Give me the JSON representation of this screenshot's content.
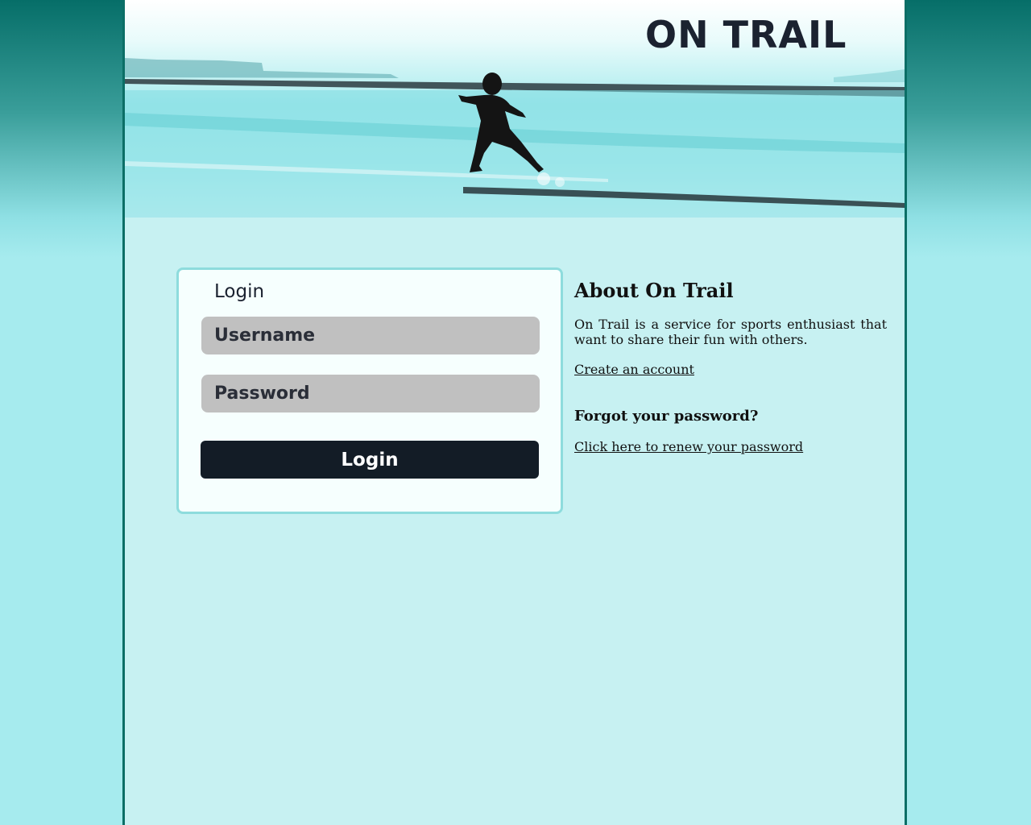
{
  "brand": {
    "title": "ON TRAIL"
  },
  "colors": {
    "background_top": "#066e68",
    "background_bottom": "#a6ebee",
    "page_background": "#c7f1f2",
    "page_border": "#0b6e66",
    "login_box_border": "#8edcdd",
    "input_background": "#c0c0c0",
    "button_background": "#131c26",
    "button_text": "#ffffff"
  },
  "login": {
    "title": "Login",
    "username_placeholder": "Username",
    "password_placeholder": "Password",
    "submit_label": "Login"
  },
  "about": {
    "heading": "About On Trail",
    "description": "On Trail is a service for sports enthusiast that want to share their fun with others.",
    "create_account_link": "Create an account",
    "forgot_heading": "Forgot your password?",
    "renew_link": "Click here to renew your password"
  },
  "banner": {
    "image": "runner-silhouette-on-beach"
  }
}
